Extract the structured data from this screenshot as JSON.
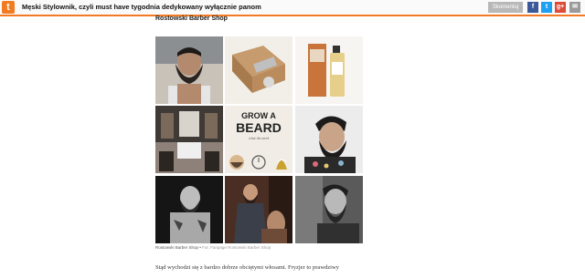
{
  "topbar": {
    "logo_letter": "t",
    "title": "Męski Stylownik, czyli must have tygodnia dedykowany wyłącznie panom",
    "comment_button": "Skomentuj",
    "share_icons": [
      "facebook-icon",
      "twitter-icon",
      "google-plus-icon",
      "mail-icon"
    ],
    "accent_color": "#f27b22"
  },
  "article": {
    "heading": "Rostowski Barber Shop",
    "gallery": {
      "tiles": [
        {
          "subject": "bearded-man-tank-top"
        },
        {
          "subject": "shaving-kit-box"
        },
        {
          "subject": "perfume-bottle"
        },
        {
          "subject": "barber-shop-interior"
        },
        {
          "subject": "grow-a-beard-poster",
          "text_line1": "GROW A",
          "text_line2": "BEARD",
          "text_line3": "what the need"
        },
        {
          "subject": "bearded-man-profile"
        },
        {
          "subject": "tattooed-bearded-man"
        },
        {
          "subject": "man-in-suit-sitting"
        },
        {
          "subject": "bearded-man-black-white"
        }
      ]
    },
    "caption": {
      "text": "Rostowski Barber Shop",
      "separator": " • ",
      "credit": "Fot. Fanpage Rostowski Barber Shop"
    },
    "body_text": "Stąd wychodzi się z bardzo dobrze obciętymi włosami. Fryzjer to prawdziwy"
  }
}
